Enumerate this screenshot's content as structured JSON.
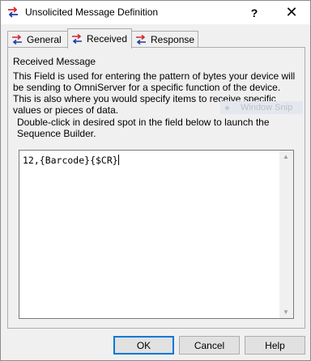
{
  "window": {
    "title": "Unsolicited Message Definition",
    "help_glyph": "?",
    "close_glyph": "✕"
  },
  "tabs": [
    {
      "label": "General",
      "icon": "message-arrows-icon"
    },
    {
      "label": "Received",
      "icon": "message-arrows-icon",
      "active": true
    },
    {
      "label": "Response",
      "icon": "message-arrows-icon"
    }
  ],
  "received": {
    "group_label": "Received Message",
    "description": "This Field is used for entering the pattern of bytes your device will be sending to OmniServer for a specific function of the device.  This is also where you would specify items to receive specific values or pieces of data.",
    "instruction": "Double-click in desired spot in the field below to launch the Sequence Builder.",
    "pattern_value": "12,{Barcode}{$CR}"
  },
  "overlay": {
    "watermark": "Window Snip"
  },
  "buttons": {
    "ok": "OK",
    "cancel": "Cancel",
    "help": "Help"
  },
  "colors": {
    "arrow_red": "#d9272e",
    "arrow_blue": "#1c3fa8",
    "focus_blue": "#0078d7"
  }
}
